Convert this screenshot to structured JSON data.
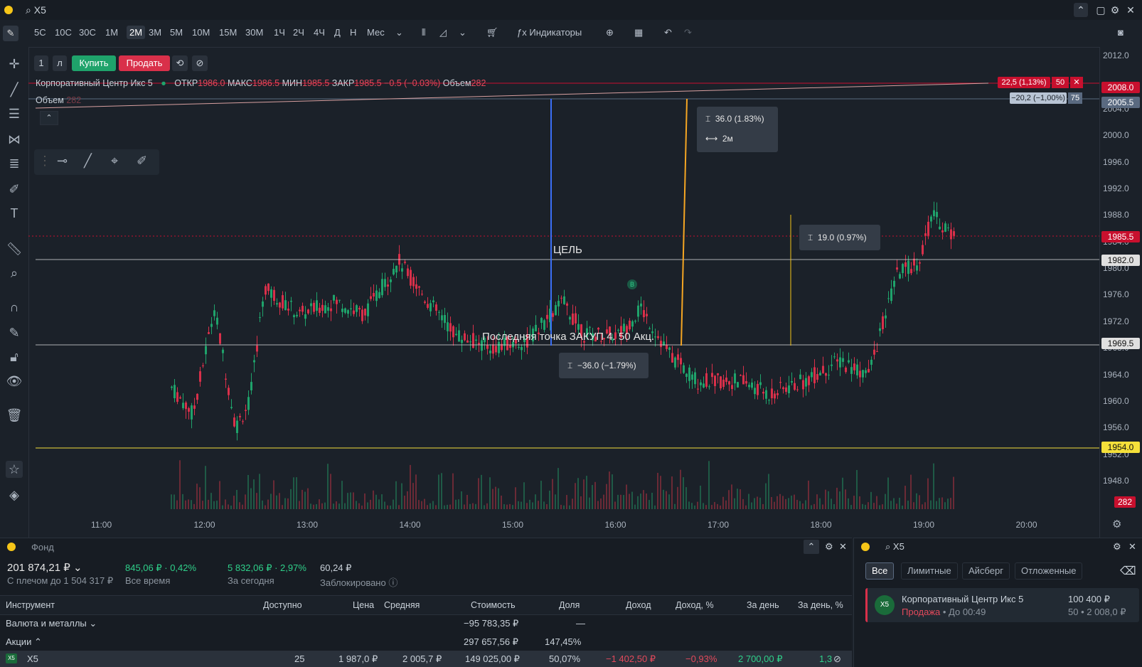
{
  "window": {
    "search": "X5"
  },
  "toolbar": {
    "timeframes": [
      "5С",
      "10С",
      "30С",
      "1М",
      "2М",
      "3М",
      "5М",
      "10М",
      "15М",
      "30М",
      "1Ч",
      "2Ч",
      "4Ч",
      "Д",
      "Н",
      "Мес"
    ],
    "active_timeframe": "2М",
    "indicators_label": "Индикаторы"
  },
  "order_bar": {
    "qty": "1",
    "lot": "л",
    "buy": "Купить",
    "sell": "Продать"
  },
  "instrument": {
    "name": "Корпоративный Центр Икс 5",
    "open_label": "ОТКР",
    "open": "1986.0",
    "high_label": "МАКС",
    "high": "1986.5",
    "low_label": "МИН",
    "low": "1985.5",
    "close_label": "ЗАКР",
    "close": "1985.5",
    "change": "−0.5 (−0.03%)",
    "volume_label": "Объем",
    "volume": "282",
    "volume_row_label": "Объем",
    "volume_row_value": "282"
  },
  "annotations": {
    "target": "ЦЕЛЬ",
    "last_buy": "Последняя точка ЗАКУП 4. 50 Акц.",
    "measure1": "36.0 (1.83%)",
    "measure1_time": "2м",
    "measure2": "19.0 (0.97%)",
    "measure3": "−36.0 (−1.79%)",
    "order_tag1": "22,5 (1,13%)",
    "order_tag1_qty": "50",
    "order_tag2": "−20,2 (−1,00%)",
    "order_tag2_qty": "75",
    "marker_b": "B"
  },
  "price_axis": {
    "ticks": [
      "2012.0",
      "2004.0",
      "2000.0",
      "1996.0",
      "1992.0",
      "1988.0",
      "1984.0",
      "1980.0",
      "1976.0",
      "1972.0",
      "1968.0",
      "1964.0",
      "1960.0",
      "1956.0",
      "1952.0",
      "1948.0"
    ],
    "labels": [
      {
        "text": "2008.0",
        "color": "#c8102e"
      },
      {
        "text": "2005.5",
        "color": "#5a6a80"
      },
      {
        "text": "1985.5",
        "color": "#c8102e"
      },
      {
        "text": "1982.0",
        "color": "#e0e0e0"
      },
      {
        "text": "1969.5",
        "color": "#e0e0e0"
      },
      {
        "text": "1954.0",
        "color": "#f5e03a"
      },
      {
        "text": "282",
        "color": "#c8102e"
      }
    ]
  },
  "time_axis": [
    "11:00",
    "12:00",
    "13:00",
    "14:00",
    "15:00",
    "16:00",
    "17:00",
    "18:00",
    "19:00",
    "20:00"
  ],
  "portfolio": {
    "title": "Фонд",
    "balance": "201 874,21 ₽",
    "leverage": "С плечом до 1 504 317 ₽",
    "alltime_value": "845,06 ₽ · 0,42%",
    "alltime_label": "Все время",
    "today_value": "5 832,06 ₽ · 2,97%",
    "today_label": "За сегодня",
    "blocked_value": "60,24 ₽",
    "blocked_label": "Заблокировано",
    "columns": [
      "Инструмент",
      "Доступно",
      "Цена",
      "Средняя",
      "Стоимость",
      "Доля",
      "Доход",
      "Доход, %",
      "За день",
      "За день, %"
    ],
    "groups": [
      {
        "name": "Валюта и металлы",
        "value": "−95 783,35 ₽",
        "share": "—"
      },
      {
        "name": "Акции",
        "value": "297 657,56 ₽",
        "share": "147,45%"
      }
    ],
    "row": {
      "name": "X5",
      "available": "25",
      "price": "1 987,0 ₽",
      "avg": "2 005,7 ₽",
      "value": "149 025,00 ₽",
      "share": "50,07%",
      "income": "−1 402,50 ₽",
      "income_pct": "−0,93%",
      "day": "2 700,00 ₽",
      "day_pct": "1,3"
    }
  },
  "orders": {
    "search": "X5",
    "tabs": [
      "Все",
      "Лимитные",
      "Айсберг",
      "Отложенные"
    ],
    "item": {
      "name": "Корпоративный Центр Икс 5",
      "amount": "100 400 ₽",
      "side": "Продажа",
      "until": "• До 00:49",
      "detail": "50 • 2 008,0 ₽"
    }
  },
  "colors": {
    "up": "#1fa36b",
    "down": "#d9304a",
    "target_line": "#e0e0e0",
    "stop_line": "#f5e03a"
  }
}
